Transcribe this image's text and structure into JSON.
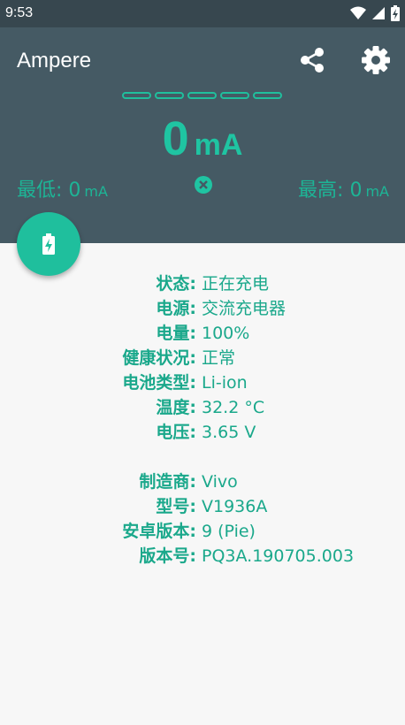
{
  "statusbar": {
    "time": "9:53"
  },
  "app": {
    "title": "Ampere"
  },
  "meter": {
    "value": "0",
    "unit": "mA",
    "segments": 5
  },
  "min": {
    "label": "最低:",
    "value": "0",
    "unit": "mA"
  },
  "max": {
    "label": "最高:",
    "value": "0",
    "unit": "mA"
  },
  "colors": {
    "accent": "#1fbf9d",
    "header": "#455a64",
    "statusbar": "#37474f"
  },
  "battery_info": [
    {
      "label": "状态:",
      "value": "正在充电"
    },
    {
      "label": "电源:",
      "value": "交流充电器"
    },
    {
      "label": "电量:",
      "value": "100%"
    },
    {
      "label": "健康状况:",
      "value": "正常"
    },
    {
      "label": "电池类型:",
      "value": "Li-ion"
    },
    {
      "label": "温度:",
      "value": "32.2 °C"
    },
    {
      "label": "电压:",
      "value": "3.65 V"
    }
  ],
  "device_info": [
    {
      "label": "制造商:",
      "value": "Vivo"
    },
    {
      "label": "型号:",
      "value": "V1936A"
    },
    {
      "label": "安卓版本:",
      "value": "9 (Pie)"
    },
    {
      "label": "版本号:",
      "value": "PQ3A.190705.003"
    }
  ]
}
